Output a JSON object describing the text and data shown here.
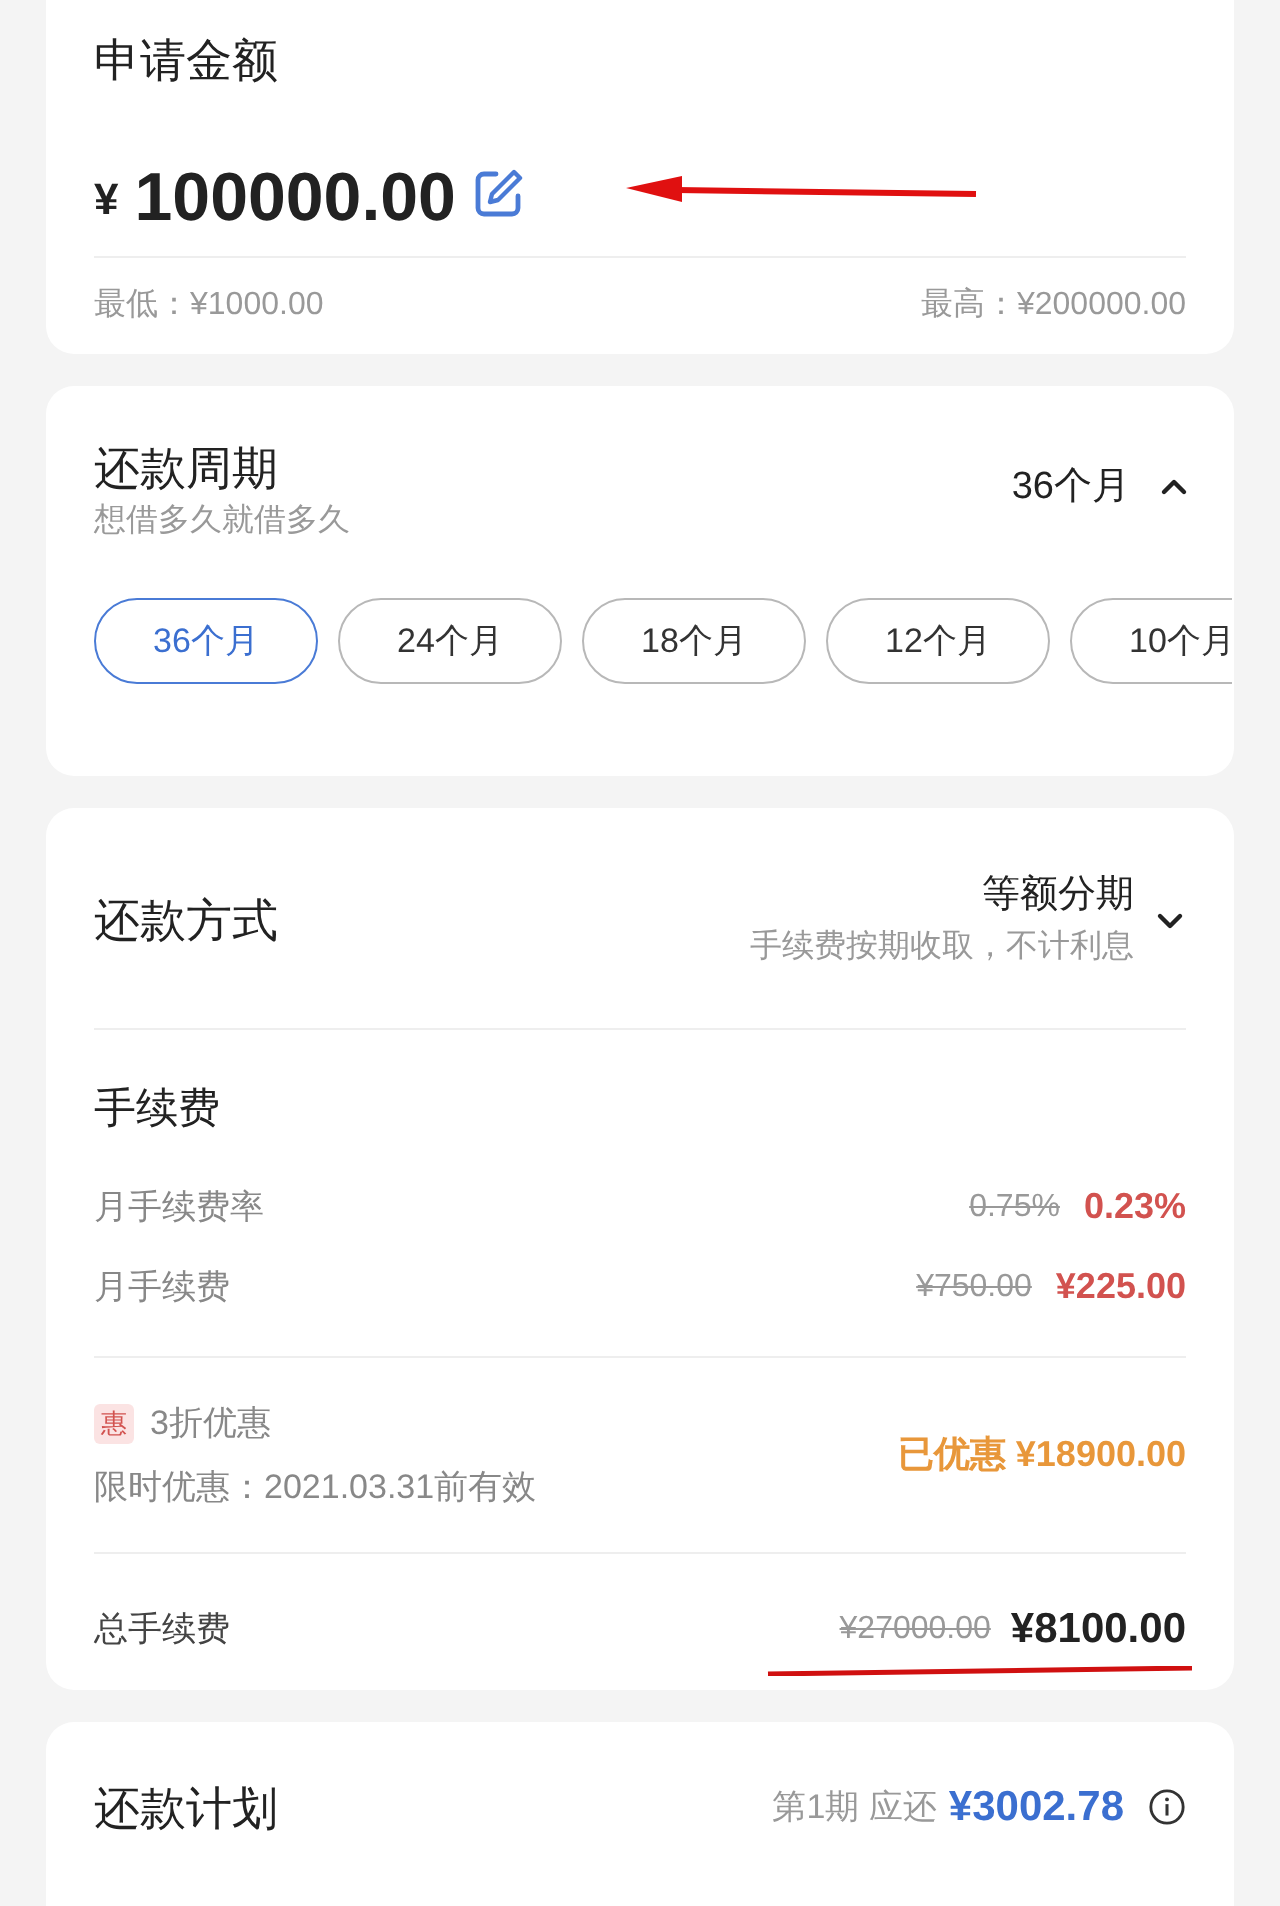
{
  "amount_card": {
    "title": "申请金额",
    "currency": "¥",
    "amount": "100000.00",
    "min": "最低：¥1000.00",
    "max": "最高：¥200000.00",
    "arrow_marked": true
  },
  "period_card": {
    "title": "还款周期",
    "subtitle": "想借多久就借多久",
    "value": "36个月",
    "expanded": true,
    "options": [
      {
        "label": "36个月",
        "selected": true
      },
      {
        "label": "24个月",
        "selected": false
      },
      {
        "label": "18个月",
        "selected": false
      },
      {
        "label": "12个月",
        "selected": false
      },
      {
        "label": "10个月",
        "selected": false
      }
    ]
  },
  "method_card": {
    "title": "还款方式",
    "value": "等额分期",
    "note": "手续费按期收取，不计利息",
    "expanded": false,
    "fee_title": "手续费",
    "fee_rows": [
      {
        "label": "月手续费率",
        "old": "0.75%",
        "new": "0.23%"
      },
      {
        "label": "月手续费",
        "old": "¥750.00",
        "new": "¥225.00"
      }
    ],
    "discount": {
      "badge": "惠",
      "title": "3折优惠",
      "validity": "限时优惠：2021.03.31前有效",
      "saved": "已优惠 ¥18900.00"
    },
    "total": {
      "label": "总手续费",
      "old": "¥27000.00",
      "new": "¥8100.00",
      "underlined": true
    }
  },
  "plan_card": {
    "title": "还款计划",
    "period": "第1期 应还",
    "amount": "¥3002.78"
  }
}
